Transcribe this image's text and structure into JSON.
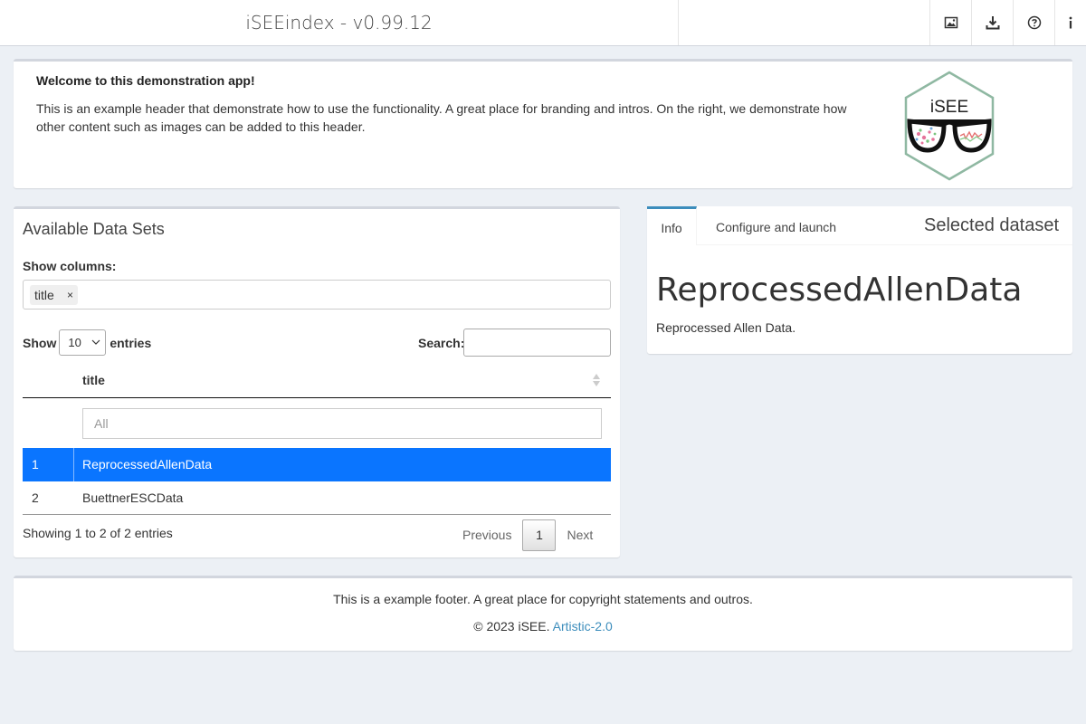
{
  "navbar": {
    "brand": "iSEEindex - v0.99.12",
    "icons": [
      "image-icon",
      "download-icon",
      "help-circle-icon",
      "info-icon"
    ]
  },
  "header": {
    "title": "Welcome to this demonstration app!",
    "text": "This is an example header that demonstrate how to use the functionality. A great place for branding and intros. On the right, we demonstrate how other content such as images can be added to this header.",
    "logo_text": "iSEE"
  },
  "datasets": {
    "title": "Available Data Sets",
    "show_columns_label": "Show columns:",
    "selected_column_tag": "title",
    "tag_remove": "×",
    "length": {
      "prefix": "Show",
      "value": "10",
      "suffix": "entries"
    },
    "search_label": "Search:",
    "search_value": "",
    "column_header": "title",
    "filter_placeholder": "All",
    "rows": [
      {
        "num": "1",
        "title": "ReprocessedAllenData",
        "selected": true
      },
      {
        "num": "2",
        "title": "BuettnerESCData",
        "selected": false
      }
    ],
    "info": "Showing 1 to 2 of 2 entries",
    "pager": {
      "previous": "Previous",
      "current": "1",
      "next": "Next"
    }
  },
  "selected": {
    "tabs": [
      "Info",
      "Configure and launch"
    ],
    "active_tab": "Info",
    "title": "Selected dataset",
    "name": "ReprocessedAllenData",
    "description": "Reprocessed Allen Data."
  },
  "footer": {
    "line1": "This is a example footer. A great place for copyright statements and outros.",
    "copyright": "© 2023 iSEE.",
    "license_link": "Artistic-2.0"
  },
  "colors": {
    "selected_row": "#0a75ff",
    "link": "#3c8dbc",
    "background": "#ecf0f5"
  }
}
